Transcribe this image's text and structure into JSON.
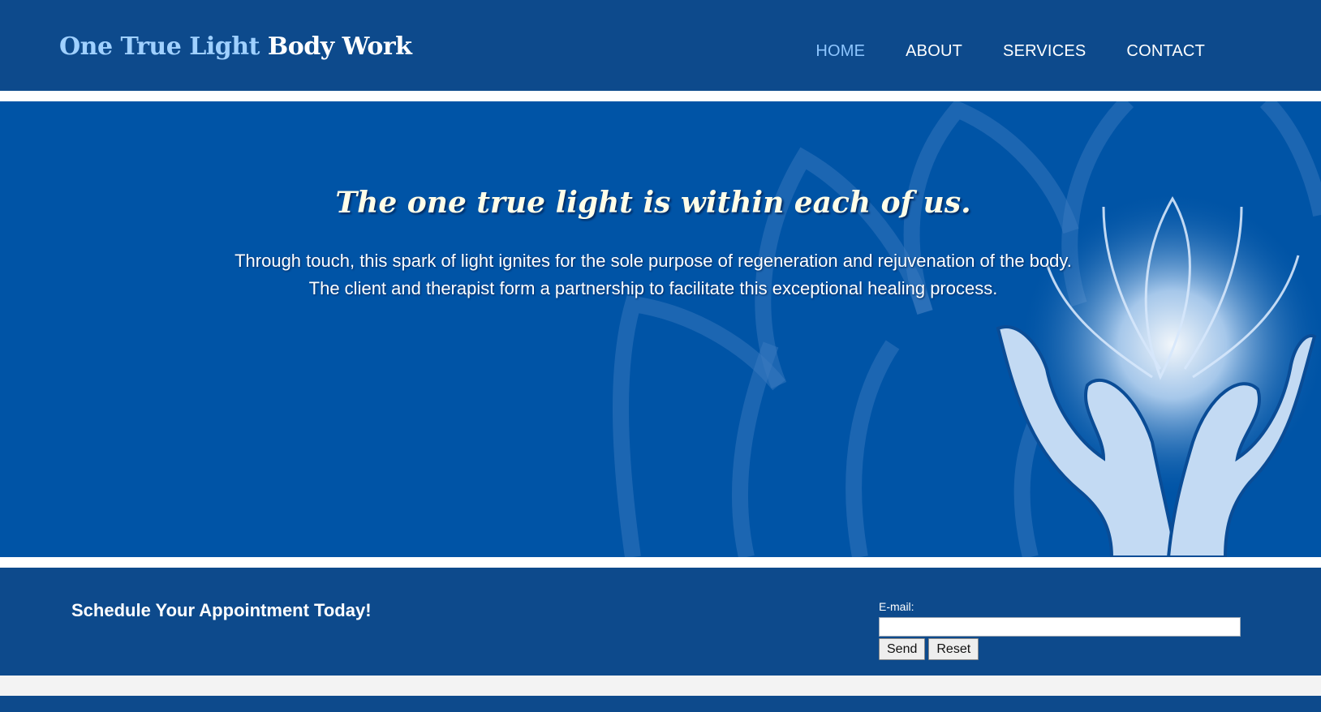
{
  "header": {
    "logo_part1": "One True Light",
    "logo_part2": "Body Work",
    "nav": [
      {
        "label": "HOME",
        "active": true
      },
      {
        "label": "ABOUT",
        "active": false
      },
      {
        "label": "SERVICES",
        "active": false
      },
      {
        "label": "CONTACT",
        "active": false
      }
    ]
  },
  "hero": {
    "title": "The one true light is within each of us.",
    "line1": "Through touch, this spark of light ignites for the sole purpose of regeneration and rejuvenation of the body.",
    "line2": "The client and therapist form a partnership to facilitate this exceptional healing process.",
    "illustration": "hands-holding-lotus-light-icon"
  },
  "footer": {
    "cta": "Schedule Your Appointment Today!",
    "email_label": "E-mail:",
    "email_value": "",
    "send_label": "Send",
    "reset_label": "Reset"
  },
  "colors": {
    "header_bg": "#0d4a8c",
    "hero_bg": "#0054a6",
    "logo_accent": "#9fd0ff",
    "nav_active": "#8ec6ff"
  }
}
